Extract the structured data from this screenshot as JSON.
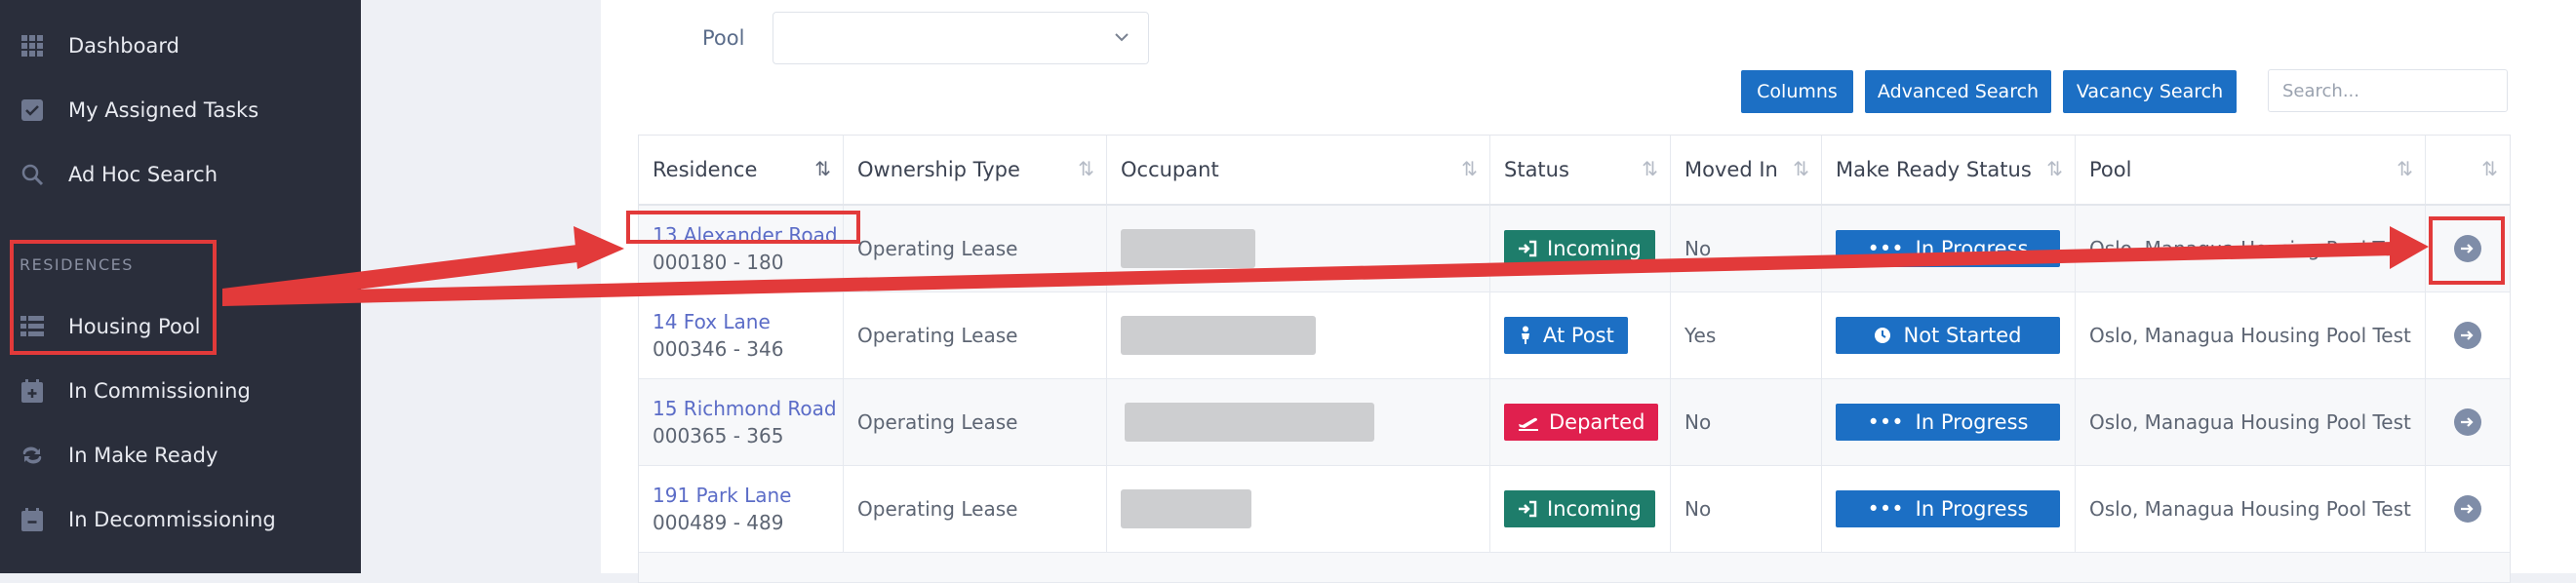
{
  "sidebar": {
    "items_top": [
      {
        "label": "Dashboard",
        "icon": "grid-icon"
      },
      {
        "label": "My Assigned Tasks",
        "icon": "check-icon"
      },
      {
        "label": "Ad Hoc Search",
        "icon": "search-icon"
      }
    ],
    "section_label": "RESIDENCES",
    "items_residences": [
      {
        "label": "Housing Pool",
        "icon": "list-icon"
      },
      {
        "label": "In Commissioning",
        "icon": "calendar-plus-icon"
      },
      {
        "label": "In Make Ready",
        "icon": "repeat-icon"
      },
      {
        "label": "In Decommissioning",
        "icon": "calendar-minus-icon"
      }
    ]
  },
  "filters": {
    "pool_label": "Pool",
    "pool_value": ""
  },
  "toolbar": {
    "columns_label": "Columns",
    "advanced_search_label": "Advanced Search",
    "vacancy_search_label": "Vacancy Search",
    "search_placeholder": "Search..."
  },
  "table": {
    "headers": [
      "Residence",
      "Ownership Type",
      "Occupant",
      "Status",
      "Moved In",
      "Make Ready Status",
      "Pool",
      ""
    ],
    "rows": [
      {
        "residence": "13 Alexander Road",
        "code": "000180 - 180",
        "ownership": "Operating Lease",
        "status": "Incoming",
        "moved_in": "No",
        "make_ready": "In Progress",
        "pool": "Oslo, Managua Housing Pool Test"
      },
      {
        "residence": "14 Fox Lane",
        "code": "000346 - 346",
        "ownership": "Operating Lease",
        "status": "At Post",
        "moved_in": "Yes",
        "make_ready": "Not Started",
        "pool": "Oslo, Managua Housing Pool Test"
      },
      {
        "residence": "15 Richmond Road",
        "code": "000365 - 365",
        "ownership": "Operating Lease",
        "status": "Departed",
        "moved_in": "No",
        "make_ready": "In Progress",
        "pool": "Oslo, Managua Housing Pool Test"
      },
      {
        "residence": "191 Park Lane",
        "code": "000489 - 489",
        "ownership": "Operating Lease",
        "status": "Incoming",
        "moved_in": "No",
        "make_ready": "In Progress",
        "pool": "Oslo, Managua Housing Pool Test"
      }
    ]
  },
  "colors": {
    "sidebar_bg": "#2a2e3b",
    "primary": "#1c6fc4",
    "status_incoming": "#1e7d6b",
    "status_at_post": "#1c6fc4",
    "status_departed": "#e0204e",
    "link": "#5b6cc7",
    "annotation": "#e23a3a"
  }
}
